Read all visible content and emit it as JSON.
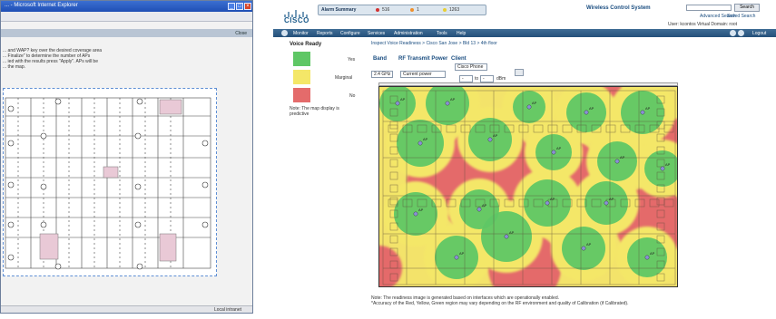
{
  "left_window": {
    "title": "... - Microsoft Internet Explorer",
    "close_link": "Close",
    "instructions": [
      "... and WAP? key over the desired coverage area",
      "... Finalize\" to determine the number of APs",
      "... ied with the results press \"Apply\". APs will be",
      "... the map."
    ],
    "status_text": "Local intranet"
  },
  "right_window": {
    "logo_text": "CISCO",
    "alarm_summary": "Alarm Summary",
    "alarm_counts": [
      "516",
      "1",
      "1263"
    ],
    "app_title": "Wireless Control System",
    "search_button": "Search",
    "search_links": [
      "Advanced Search",
      "Saved Search"
    ],
    "user_line": "User: kcontos  Virtual Domain: root",
    "nav": [
      "Monitor",
      "Reports",
      "Configure",
      "Services",
      "Administration",
      "Tools",
      "Help"
    ],
    "logout": "Logout",
    "breadcrumb": "Inspect Voice Readiness > Cisco San Jose > Bld 13 > 4th floor",
    "legend": {
      "title": "Voice Ready",
      "items": [
        {
          "label": "Yes",
          "color": "#5fc765"
        },
        {
          "label": "Marginal",
          "color": "#f4e768"
        },
        {
          "label": "No",
          "color": "#e46b6b"
        }
      ],
      "note": "Note: The map display is predictive"
    },
    "tabs": [
      "Band",
      "RF Transmit Power",
      "Client"
    ],
    "band_value": "2.4 GHz",
    "power_value": "Current power",
    "client_value": "Cisco Phone",
    "range_from": "-",
    "range_to": "-",
    "range_unit": "dBm",
    "footer_notes": [
      "Note: The readiness image is generated based on interfaces which are operationally enabled.",
      "*Accuracy of the Red, Yellow, Green region may vary depending on the RF environment and quality of Calibration (if Calibrated)."
    ]
  },
  "colors": {
    "yes": "#5fc765",
    "marginal": "#f4e768",
    "no": "#e46b6b"
  },
  "heatmap": {
    "ap_labels": [
      "AP",
      "AP",
      "AP",
      "AP",
      "AP",
      "AP",
      "AP",
      "AP",
      "AP",
      "AP",
      "AP",
      "AP",
      "AP",
      "AP",
      "AP",
      "AP",
      "AP",
      "AP"
    ]
  }
}
